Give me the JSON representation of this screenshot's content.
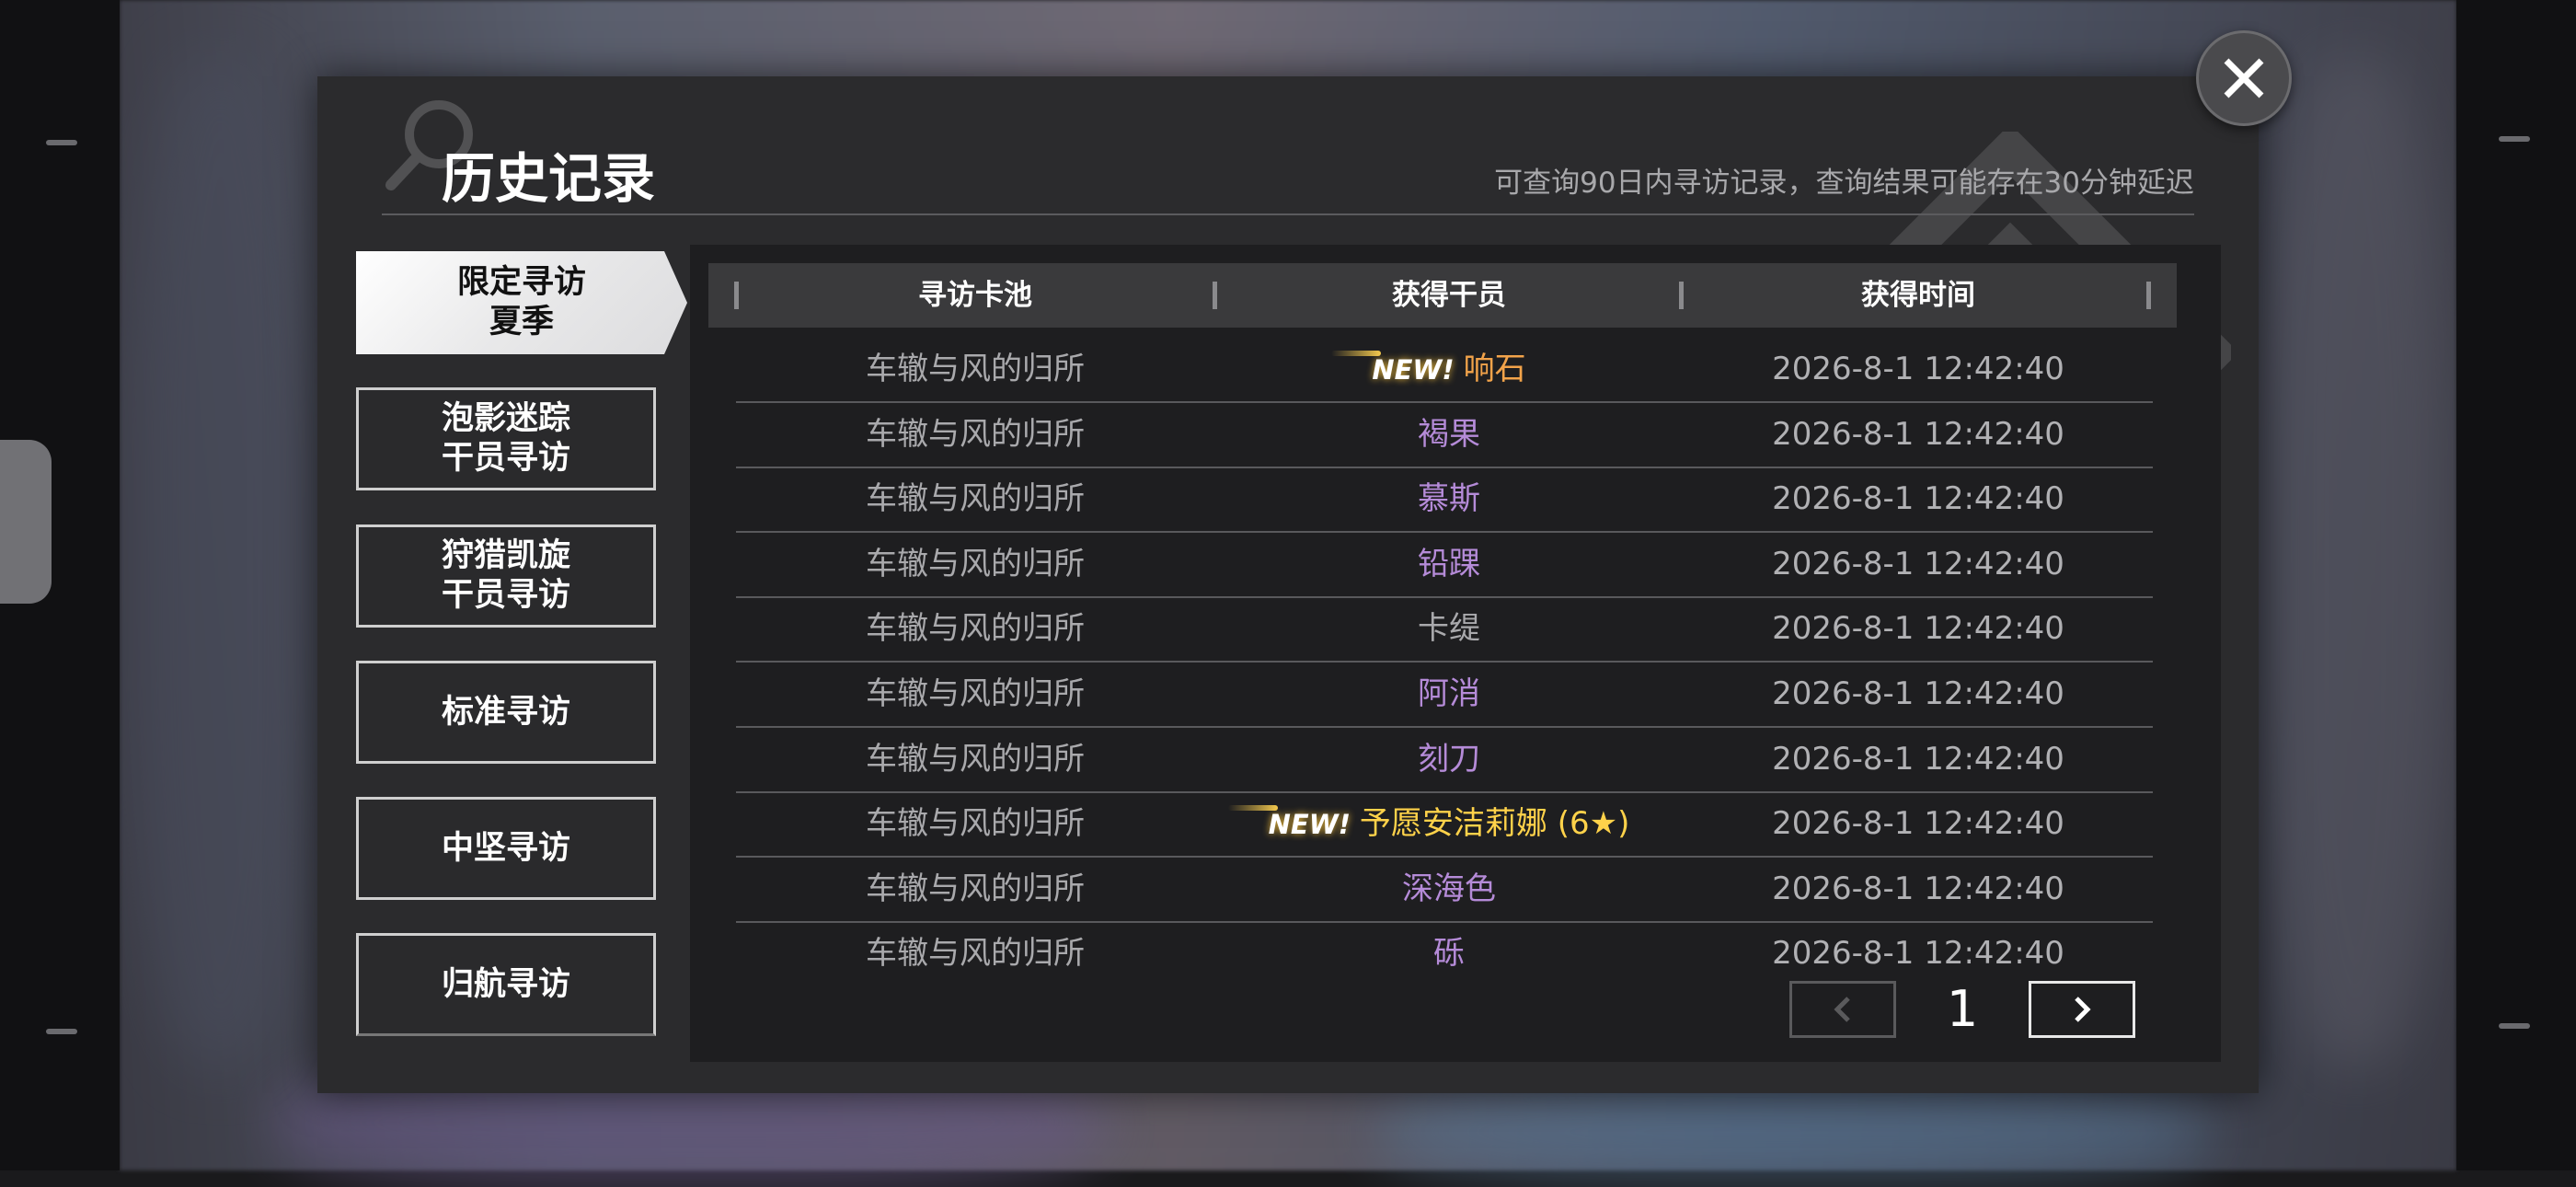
{
  "header": {
    "title": "历史记录",
    "subtitle": "可查询90日内寻访记录，查询结果可能存在30分钟延迟"
  },
  "tabs": [
    {
      "line1": "限定寻访",
      "line2": "夏季",
      "active": true
    },
    {
      "line1": "泡影迷踪",
      "line2": "干员寻访",
      "active": false
    },
    {
      "line1": "狩猎凯旋",
      "line2": "干员寻访",
      "active": false
    },
    {
      "line1": "标准寻访",
      "line2": "",
      "active": false
    },
    {
      "line1": "中坚寻访",
      "line2": "",
      "active": false
    },
    {
      "line1": "归航寻访",
      "line2": "",
      "active": false
    }
  ],
  "table": {
    "headers": [
      "寻访卡池",
      "获得干员",
      "获得时间"
    ],
    "new_label": "NEW!",
    "rows": [
      {
        "pool": "车辙与风的归所",
        "operator": "响石",
        "time": "2026-8-1 12:42:40",
        "is_new": true,
        "rarity_color": "#f2a34a"
      },
      {
        "pool": "车辙与风的归所",
        "operator": "褐果",
        "time": "2026-8-1 12:42:40",
        "is_new": false,
        "rarity_color": "#b58bd8"
      },
      {
        "pool": "车辙与风的归所",
        "operator": "慕斯",
        "time": "2026-8-1 12:42:40",
        "is_new": false,
        "rarity_color": "#b58bd8"
      },
      {
        "pool": "车辙与风的归所",
        "operator": "铅踝",
        "time": "2026-8-1 12:42:40",
        "is_new": false,
        "rarity_color": "#b58bd8"
      },
      {
        "pool": "车辙与风的归所",
        "operator": "卡缇",
        "time": "2026-8-1 12:42:40",
        "is_new": false,
        "rarity_color": "#a9a9ac"
      },
      {
        "pool": "车辙与风的归所",
        "operator": "阿消",
        "time": "2026-8-1 12:42:40",
        "is_new": false,
        "rarity_color": "#b58bd8"
      },
      {
        "pool": "车辙与风的归所",
        "operator": "刻刀",
        "time": "2026-8-1 12:42:40",
        "is_new": false,
        "rarity_color": "#b58bd8"
      },
      {
        "pool": "车辙与风的归所",
        "operator": "予愿安洁莉娜 (6★)",
        "time": "2026-8-1 12:42:40",
        "is_new": true,
        "rarity_color": "#ffd24a"
      },
      {
        "pool": "车辙与风的归所",
        "operator": "深海色",
        "time": "2026-8-1 12:42:40",
        "is_new": false,
        "rarity_color": "#b58bd8"
      },
      {
        "pool": "车辙与风的归所",
        "operator": "砾",
        "time": "2026-8-1 12:42:40",
        "is_new": false,
        "rarity_color": "#b58bd8"
      }
    ]
  },
  "pagination": {
    "current_page": "1",
    "prev_icon": "chevron-left-icon",
    "next_icon": "chevron-right-icon"
  },
  "icons": {
    "close": "close-icon",
    "search_deco": "search-icon"
  }
}
